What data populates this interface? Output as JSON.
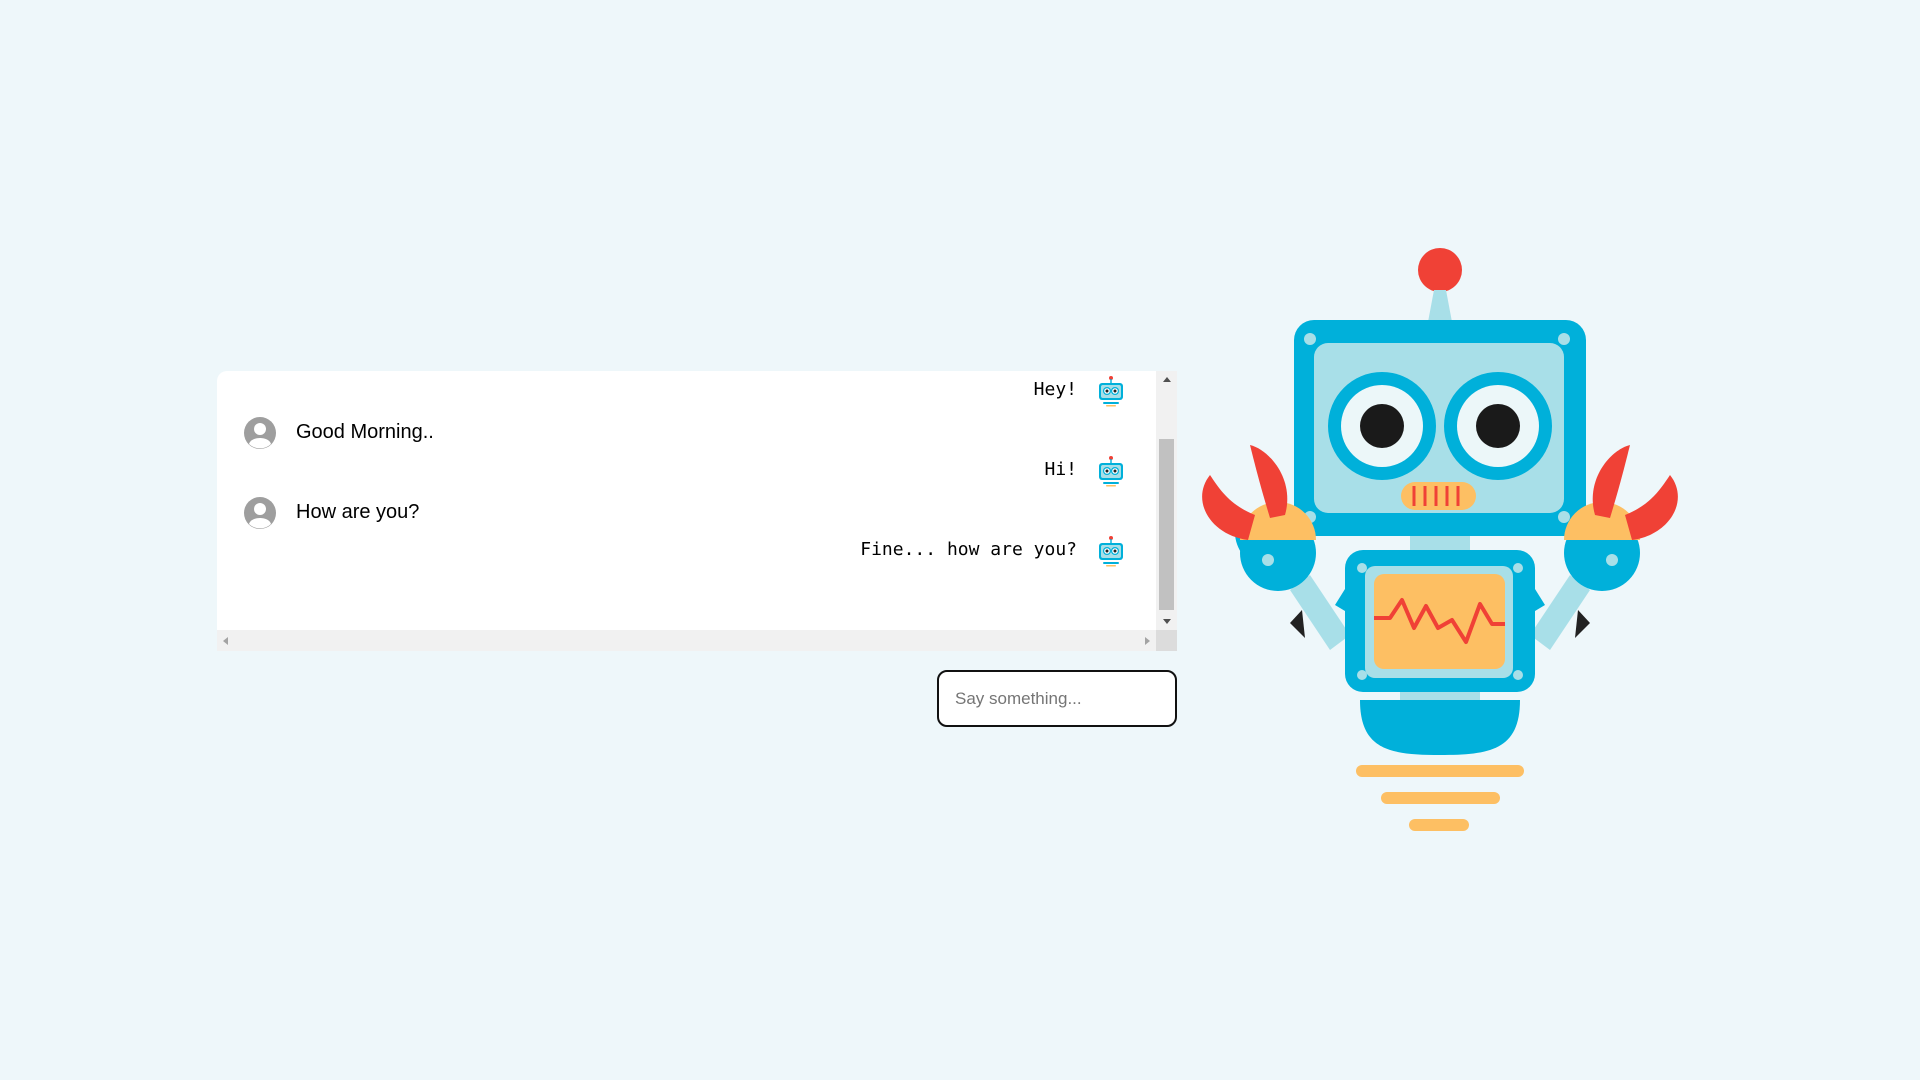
{
  "chat": {
    "messages": [
      {
        "sender": "bot",
        "text": "Hey!"
      },
      {
        "sender": "user",
        "text": "Good Morning.."
      },
      {
        "sender": "bot",
        "text": "Hi!"
      },
      {
        "sender": "user",
        "text": "How are you?"
      },
      {
        "sender": "bot",
        "text": "Fine... how are you?"
      }
    ]
  },
  "input": {
    "placeholder": "Say something...",
    "value": ""
  },
  "colors": {
    "background": "#eef7fa",
    "robot_blue": "#00b0da",
    "robot_light": "#a8dfe8",
    "accent_red": "#f04136",
    "accent_orange": "#fdbf63"
  }
}
